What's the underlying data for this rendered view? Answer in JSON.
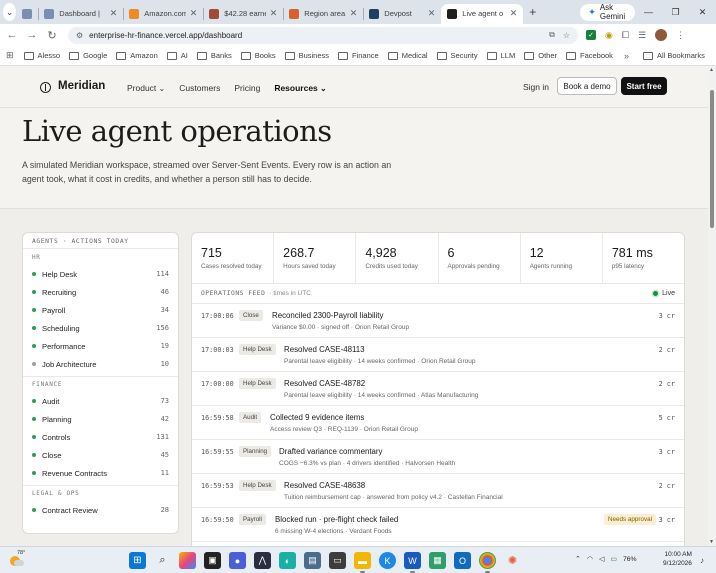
{
  "browser": {
    "tabs": [
      {
        "label": "",
        "favicon_color": "#7b8db0",
        "active": false,
        "narrow": true
      },
      {
        "label": "Dashboard |",
        "favicon_color": "#7b8db0",
        "active": false
      },
      {
        "label": "Amazon.com",
        "favicon_color": "#f08a24",
        "active": false
      },
      {
        "label": "$42.28 earne",
        "favicon_color": "#a44a3a",
        "active": false
      },
      {
        "label": "Region area",
        "favicon_color": "#d9622b",
        "active": false
      },
      {
        "label": "Devpost",
        "favicon_color": "#1f4060",
        "active": false
      },
      {
        "label": "Live agent o",
        "favicon_color": "#1f1f1f",
        "active": true
      }
    ],
    "new_tab": "+",
    "gemini_label": "Ask Gemini",
    "url": "enterprise-hr-finance.vercel.app/dashboard",
    "bookmarks": [
      "Alesso",
      "Google",
      "Amazon",
      "AI",
      "Banks",
      "Books",
      "Business",
      "Finance",
      "Medical",
      "Security",
      "LLM",
      "Other",
      "Facebook"
    ],
    "all_bookmarks": "All Bookmarks"
  },
  "site": {
    "brand": "Meridian",
    "nav": [
      {
        "label": "Product",
        "dropdown": true,
        "bold": false
      },
      {
        "label": "Customers",
        "dropdown": false,
        "bold": false
      },
      {
        "label": "Pricing",
        "dropdown": false,
        "bold": false
      },
      {
        "label": "Resources",
        "dropdown": true,
        "bold": true
      }
    ],
    "sign_in": "Sign in",
    "book_demo": "Book a demo",
    "start_free": "Start free"
  },
  "hero": {
    "title": "Live agent operations",
    "subtitle": "A simulated Meridian workspace, streamed over Server-Sent Events. Every row is an action an agent took, what it cost in credits, and whether a person still has to decide."
  },
  "sidebar": {
    "heading": "AGENTS · ACTIONS TODAY",
    "groups": [
      {
        "name": "HR",
        "items": [
          {
            "label": "Help Desk",
            "count": "114",
            "color": "#2e9e53"
          },
          {
            "label": "Recruiting",
            "count": "46",
            "color": "#2e9e53"
          },
          {
            "label": "Payroll",
            "count": "34",
            "color": "#2e9e53"
          },
          {
            "label": "Scheduling",
            "count": "156",
            "color": "#2e9e53"
          },
          {
            "label": "Performance",
            "count": "19",
            "color": "#2e9e53"
          },
          {
            "label": "Job Architecture",
            "count": "10",
            "color": "#9aa0a6"
          }
        ]
      },
      {
        "name": "FINANCE",
        "items": [
          {
            "label": "Audit",
            "count": "73",
            "color": "#2e9e53"
          },
          {
            "label": "Planning",
            "count": "42",
            "color": "#2e9e53"
          },
          {
            "label": "Controls",
            "count": "131",
            "color": "#2e9e53"
          },
          {
            "label": "Close",
            "count": "45",
            "color": "#2e9e53"
          },
          {
            "label": "Revenue Contracts",
            "count": "11",
            "color": "#2e9e53"
          }
        ]
      },
      {
        "name": "LEGAL & OPS",
        "items": [
          {
            "label": "Contract Review",
            "count": "28",
            "color": "#2e9e53"
          }
        ]
      }
    ]
  },
  "stats": [
    {
      "value": "715",
      "label": "Cases resolved today"
    },
    {
      "value": "268.7",
      "label": "Hours saved today"
    },
    {
      "value": "4,928",
      "label": "Credits used today"
    },
    {
      "value": "6",
      "label": "Approvals pending"
    },
    {
      "value": "12",
      "label": "Agents running"
    },
    {
      "value": "781 ms",
      "label": "p95 latency"
    }
  ],
  "feed": {
    "title": "OPERATIONS FEED",
    "subtitle": "· times in UTC",
    "live_label": "Live",
    "rows": [
      {
        "time": "17:00:06",
        "badge": "Close",
        "title": "Reconciled 2300-Payroll liability",
        "detail": "Variance $0.00 · signed off · Orion Retail Group",
        "credits": "3 cr",
        "approval": ""
      },
      {
        "time": "17:00:03",
        "badge": "Help Desk",
        "title": "Resolved CASE-48113",
        "detail": "Parental leave eligibility · 14 weeks confirmed · Orion Retail Group",
        "credits": "2 cr",
        "approval": ""
      },
      {
        "time": "17:00:00",
        "badge": "Help Desk",
        "title": "Resolved CASE-48782",
        "detail": "Parental leave eligibility · 14 weeks confirmed · Atlas Manufacturing",
        "credits": "2 cr",
        "approval": ""
      },
      {
        "time": "16:59:58",
        "badge": "Audit",
        "title": "Collected 9 evidence items",
        "detail": "Access review Q3 · REQ-1139 · Orion Retail Group",
        "credits": "5 cr",
        "approval": ""
      },
      {
        "time": "16:59:55",
        "badge": "Planning",
        "title": "Drafted variance commentary",
        "detail": "COGS −6.3% vs plan · 4 drivers identified · Halvorsen Health",
        "credits": "3 cr",
        "approval": ""
      },
      {
        "time": "16:59:53",
        "badge": "Help Desk",
        "title": "Resolved CASE-48638",
        "detail": "Tuition reimbursement cap · answered from policy v4.2 · Castellan Financial",
        "credits": "2 cr",
        "approval": ""
      },
      {
        "time": "16:59:50",
        "badge": "Payroll",
        "title": "Blocked run · pre-flight check failed",
        "detail": "6 missing W-4 elections · Verdant Foods",
        "credits": "3 cr",
        "approval": "Needs approval"
      }
    ]
  },
  "taskbar": {
    "temperature": "78°",
    "battery": "76%",
    "time": "10:00 AM",
    "date": "9/12/2026"
  }
}
